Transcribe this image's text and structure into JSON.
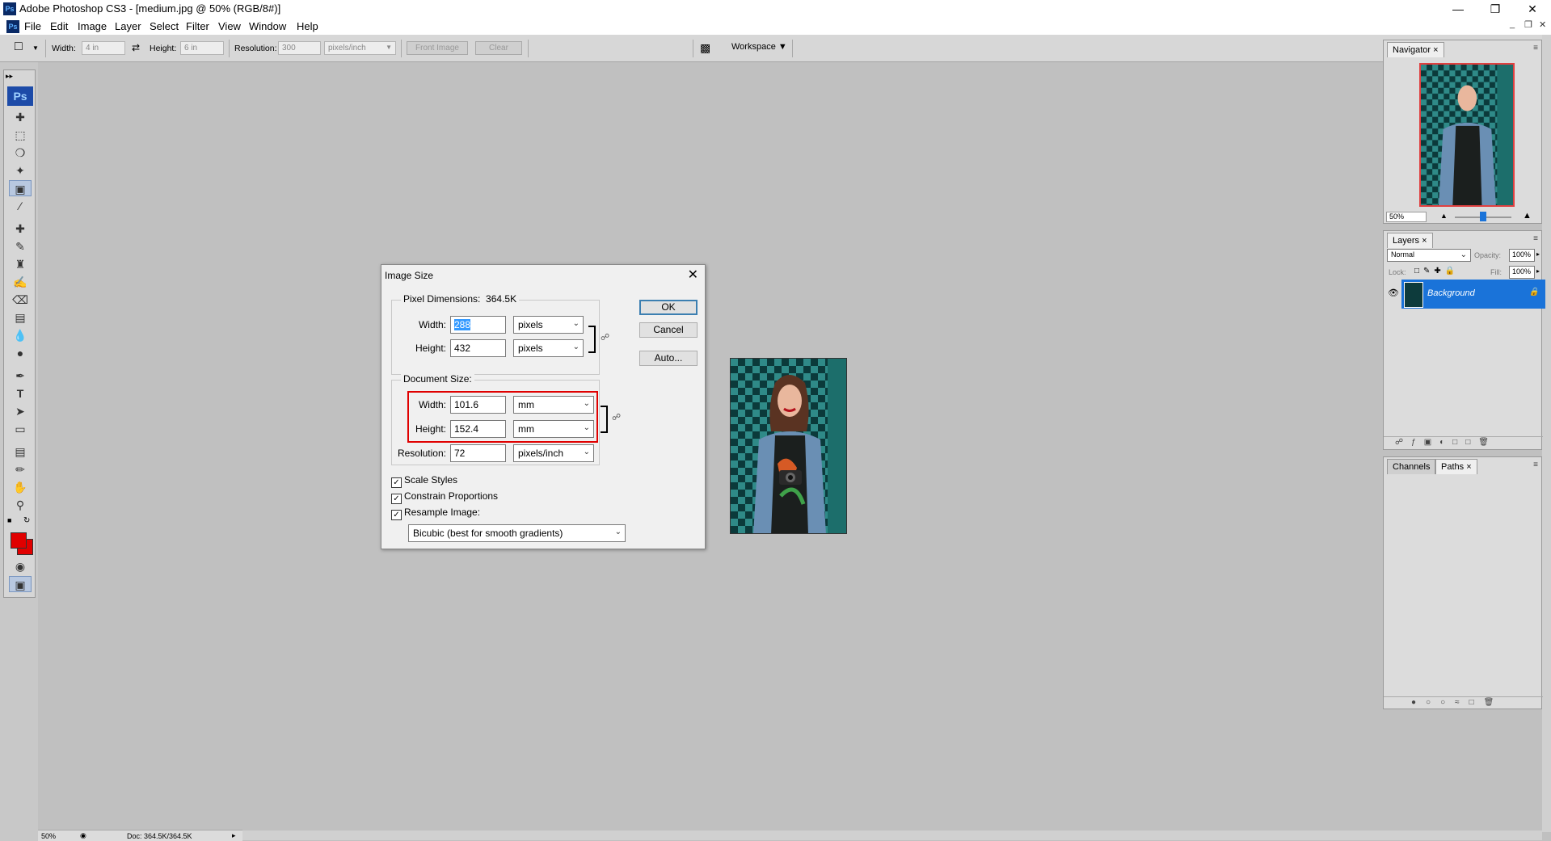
{
  "window": {
    "title": "Adobe Photoshop CS3 - [medium.jpg @ 50% (RGB/8#)]"
  },
  "menu": [
    "File",
    "Edit",
    "Image",
    "Layer",
    "Select",
    "Filter",
    "View",
    "Window",
    "Help"
  ],
  "options_bar": {
    "width_label": "Width:",
    "width_value": "4 in",
    "height_label": "Height:",
    "height_value": "6 in",
    "resolution_label": "Resolution:",
    "resolution_value": "300",
    "resolution_unit": "pixels/inch",
    "front_image": "Front Image",
    "clear": "Clear",
    "workspace": "Workspace"
  },
  "dialog": {
    "title": "Image Size",
    "pixel_dimensions_label": "Pixel Dimensions:",
    "pixel_dimensions_value": "364.5K",
    "px_width_label": "Width:",
    "px_width_value": "288",
    "px_width_unit": "pixels",
    "px_height_label": "Height:",
    "px_height_value": "432",
    "px_height_unit": "pixels",
    "document_size_label": "Document Size:",
    "doc_width_label": "Width:",
    "doc_width_value": "101.6",
    "doc_width_unit": "mm",
    "doc_height_label": "Height:",
    "doc_height_value": "152.4",
    "doc_height_unit": "mm",
    "resolution_label": "Resolution:",
    "resolution_value": "72",
    "resolution_unit": "pixels/inch",
    "scale_styles": "Scale Styles",
    "constrain_proportions": "Constrain Proportions",
    "resample_image": "Resample Image:",
    "resample_method": "Bicubic (best for smooth gradients)",
    "ok": "OK",
    "cancel": "Cancel",
    "auto": "Auto..."
  },
  "navigator": {
    "tab": "Navigator",
    "zoom": "50%"
  },
  "layers": {
    "tab": "Layers",
    "blend_mode": "Normal",
    "opacity_label": "Opacity:",
    "opacity_value": "100%",
    "lock_label": "Lock:",
    "fill_label": "Fill:",
    "fill_value": "100%",
    "layer_name": "Background"
  },
  "channels_tab": "Channels",
  "paths_tab": "Paths",
  "status": {
    "zoom": "50%",
    "doc": "Doc: 364.5K/364.5K"
  },
  "colors": {
    "foreground": "#e00000",
    "background": "#e00000",
    "highlight": "#e00000"
  }
}
